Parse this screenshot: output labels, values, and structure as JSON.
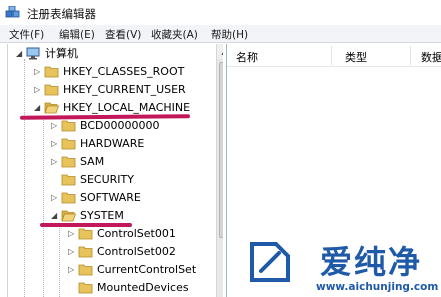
{
  "window": {
    "title": "注册表编辑器",
    "icon": "regedit-icon"
  },
  "menu": [
    {
      "label": "文件(F)"
    },
    {
      "label": "编辑(E)"
    },
    {
      "label": "查看(V)"
    },
    {
      "label": "收藏夹(A)"
    },
    {
      "label": "帮助(H)"
    }
  ],
  "tree": [
    {
      "label": "计算机",
      "level": 0,
      "expanded": true,
      "icon": "computer-icon"
    },
    {
      "label": "HKEY_CLASSES_ROOT",
      "level": 1,
      "expanded": false,
      "icon": "folder-icon"
    },
    {
      "label": "HKEY_CURRENT_USER",
      "level": 1,
      "expanded": false,
      "icon": "folder-icon"
    },
    {
      "label": "HKEY_LOCAL_MACHINE",
      "level": 1,
      "expanded": true,
      "icon": "folder-open-icon",
      "highlighted": true
    },
    {
      "label": "BCD00000000",
      "level": 2,
      "expanded": false,
      "icon": "folder-icon"
    },
    {
      "label": "HARDWARE",
      "level": 2,
      "expanded": false,
      "icon": "folder-icon"
    },
    {
      "label": "SAM",
      "level": 2,
      "expanded": false,
      "icon": "folder-icon"
    },
    {
      "label": "SECURITY",
      "level": 2,
      "expanded": false,
      "icon": "folder-icon"
    },
    {
      "label": "SOFTWARE",
      "level": 2,
      "expanded": false,
      "icon": "folder-icon"
    },
    {
      "label": "SYSTEM",
      "level": 2,
      "expanded": true,
      "icon": "folder-open-icon",
      "highlighted": true
    },
    {
      "label": "ControlSet001",
      "level": 3,
      "expanded": false,
      "icon": "folder-icon"
    },
    {
      "label": "ControlSet002",
      "level": 3,
      "expanded": false,
      "icon": "folder-icon"
    },
    {
      "label": "CurrentControlSet",
      "level": 3,
      "expanded": false,
      "icon": "folder-icon"
    },
    {
      "label": "MountedDevices",
      "level": 3,
      "expanded": false,
      "icon": "folder-icon"
    }
  ],
  "list": {
    "columns": [
      "名称",
      "类型",
      "数据"
    ]
  },
  "watermark": {
    "brand": "爱纯净",
    "url": "www.aichunjing.com"
  },
  "colors": {
    "highlight_underline": "#c2185b",
    "folder": "#e8c35c",
    "watermark": "#1f5aa8"
  }
}
